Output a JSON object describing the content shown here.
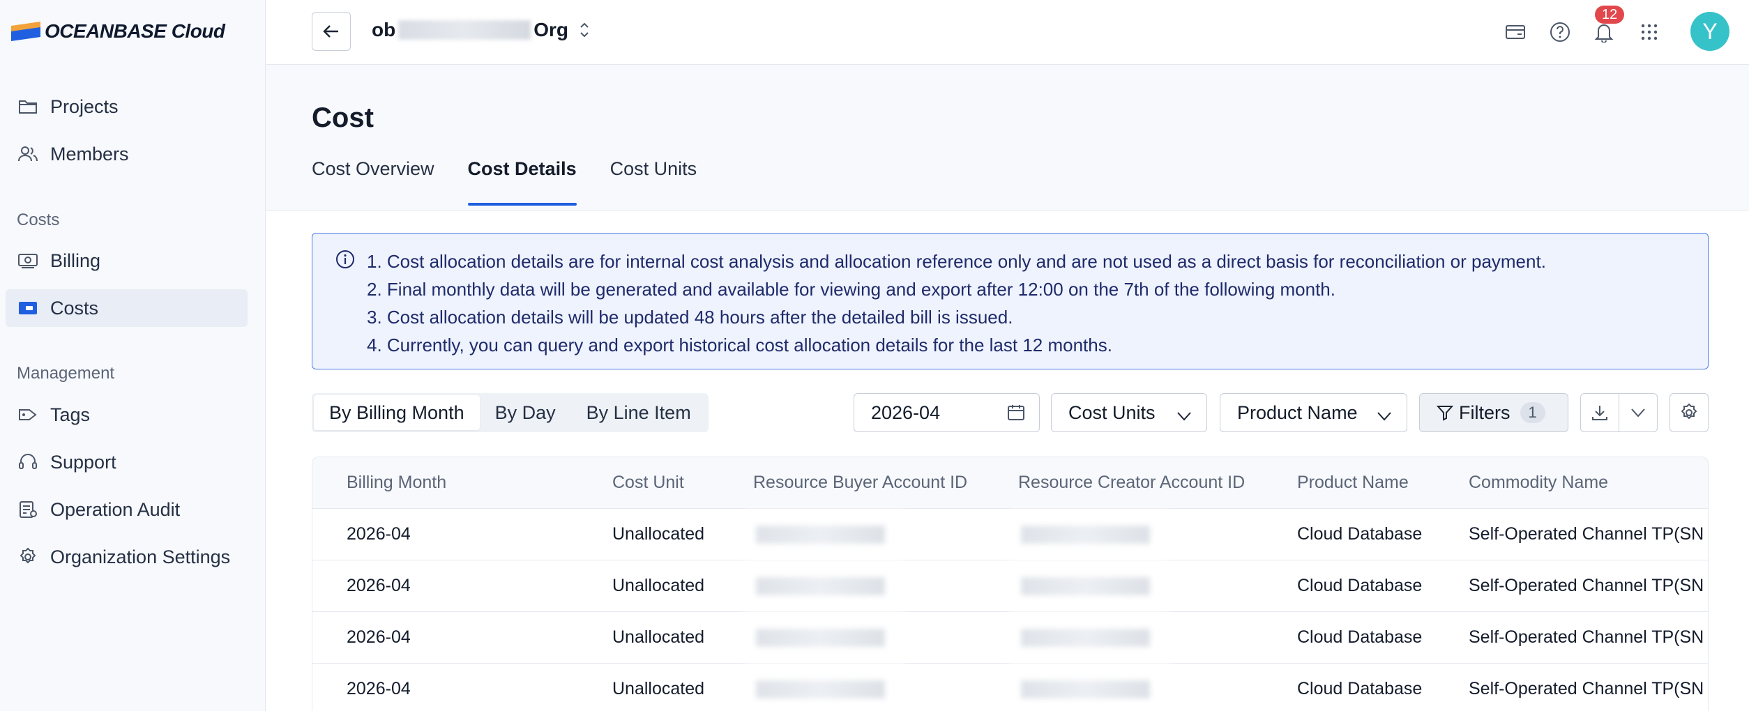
{
  "app": {
    "logo_text": "OCEANBASE Cloud"
  },
  "sidebar": {
    "items_top": [
      {
        "label": "Projects",
        "icon": "folder-icon"
      },
      {
        "label": "Members",
        "icon": "users-icon"
      }
    ],
    "section_costs": "Costs",
    "items_costs": [
      {
        "label": "Billing",
        "icon": "billing-icon"
      },
      {
        "label": "Costs",
        "icon": "costs-icon",
        "active": true
      }
    ],
    "section_management": "Management",
    "items_management": [
      {
        "label": "Tags",
        "icon": "tag-icon"
      },
      {
        "label": "Support",
        "icon": "headset-icon"
      },
      {
        "label": "Operation Audit",
        "icon": "audit-icon"
      },
      {
        "label": "Organization Settings",
        "icon": "gear-icon"
      }
    ]
  },
  "header": {
    "org_prefix": "ob",
    "org_suffix": "Org",
    "notification_count": "12",
    "avatar_initial": "Y"
  },
  "page": {
    "title": "Cost",
    "tabs": [
      {
        "label": "Cost Overview"
      },
      {
        "label": "Cost Details",
        "active": true
      },
      {
        "label": "Cost Units"
      }
    ]
  },
  "notice": {
    "lines": [
      "1. Cost allocation details are for internal cost analysis and allocation reference only and are not used as a direct basis for reconciliation or payment.",
      "2. Final monthly data will be generated and available for viewing and export after 12:00 on the 7th of the following month.",
      "3. Cost allocation details will be updated 48 hours after the detailed bill is issued.",
      "4. Currently, you can query and export historical cost allocation details for the last 12 months."
    ]
  },
  "toolbar": {
    "segments": [
      {
        "label": "By Billing Month",
        "active": true
      },
      {
        "label": "By Day"
      },
      {
        "label": "By Line Item"
      }
    ],
    "month_value": "2026-04",
    "cost_units_label": "Cost Units",
    "product_name_label": "Product Name",
    "filters_label": "Filters",
    "filters_count": "1"
  },
  "table": {
    "columns": [
      "Billing Month",
      "Cost Unit",
      "Resource Buyer Account ID",
      "Resource Creator Account ID",
      "Product Name",
      "Commodity Name"
    ],
    "rows": [
      {
        "billing_month": "2026-04",
        "cost_unit": "Unallocated",
        "product_name": "Cloud Database",
        "commodity_name": "Self-Operated Channel TP(SN"
      },
      {
        "billing_month": "2026-04",
        "cost_unit": "Unallocated",
        "product_name": "Cloud Database",
        "commodity_name": "Self-Operated Channel TP(SN"
      },
      {
        "billing_month": "2026-04",
        "cost_unit": "Unallocated",
        "product_name": "Cloud Database",
        "commodity_name": "Self-Operated Channel TP(SN"
      },
      {
        "billing_month": "2026-04",
        "cost_unit": "Unallocated",
        "product_name": "Cloud Database",
        "commodity_name": "Self-Operated Channel TP(SN"
      }
    ]
  },
  "colors": {
    "accent": "#1f5fe0",
    "notice_border": "#4a7ee8",
    "notice_bg": "#eef3fd",
    "badge": "#e2474c",
    "avatar": "#36c2c9"
  }
}
